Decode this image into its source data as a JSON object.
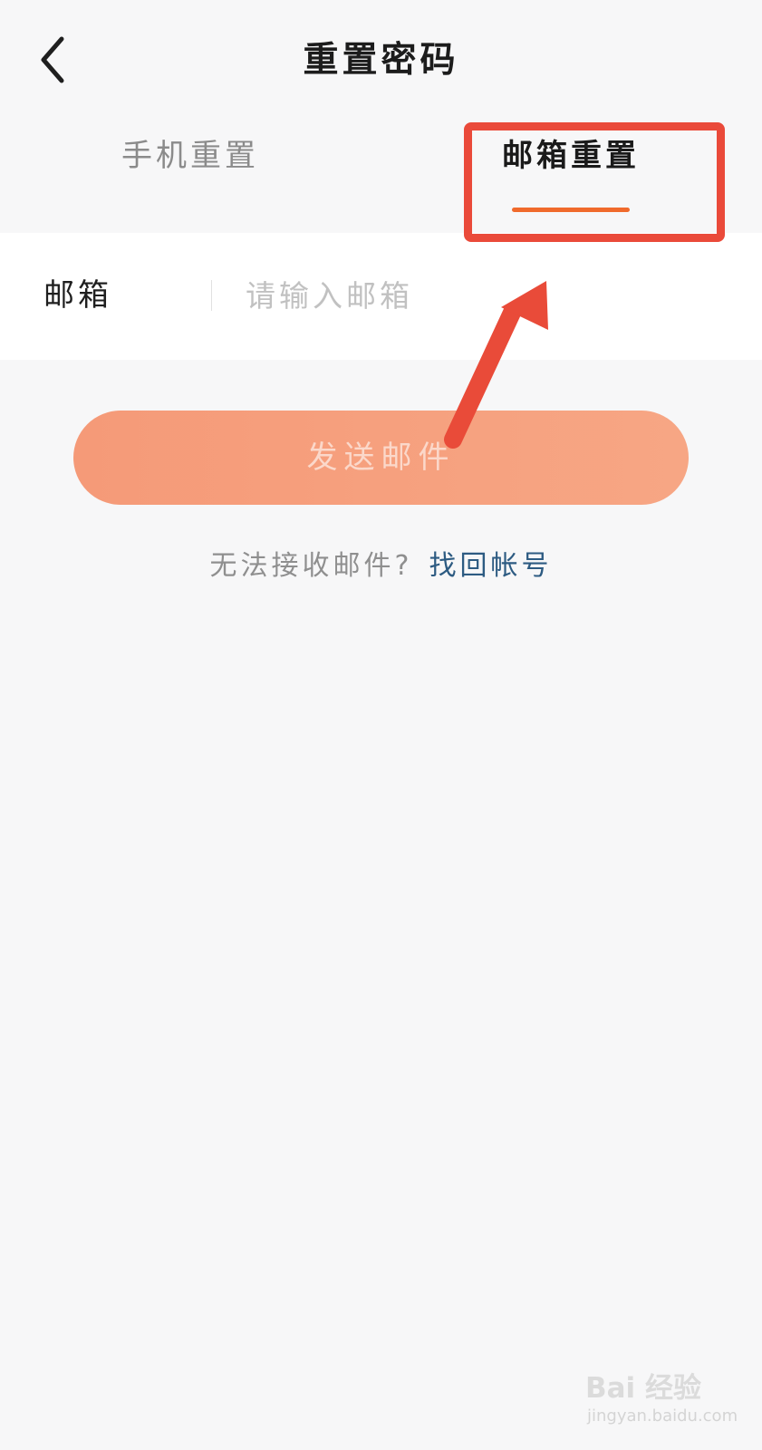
{
  "header": {
    "back_icon": "chevron-left-icon",
    "title": "重置密码"
  },
  "tabs": [
    {
      "label": "手机重置",
      "active": false
    },
    {
      "label": "邮箱重置",
      "active": true
    }
  ],
  "form": {
    "email_label": "邮箱",
    "email_placeholder": "请输入邮箱",
    "email_value": ""
  },
  "send_button": {
    "label": "发送邮件",
    "enabled": false
  },
  "help": {
    "text": "无法接收邮件?",
    "link": "找回帐号"
  },
  "watermark": {
    "brand": "Bai 经验",
    "url": "jingyan.baidu.com"
  },
  "colors": {
    "background": "#f7f7f8",
    "card": "#ffffff",
    "accent": "#f06a2c",
    "button": "#f59a78",
    "link": "#2d5b82",
    "annotation": "#ea4a3a"
  }
}
